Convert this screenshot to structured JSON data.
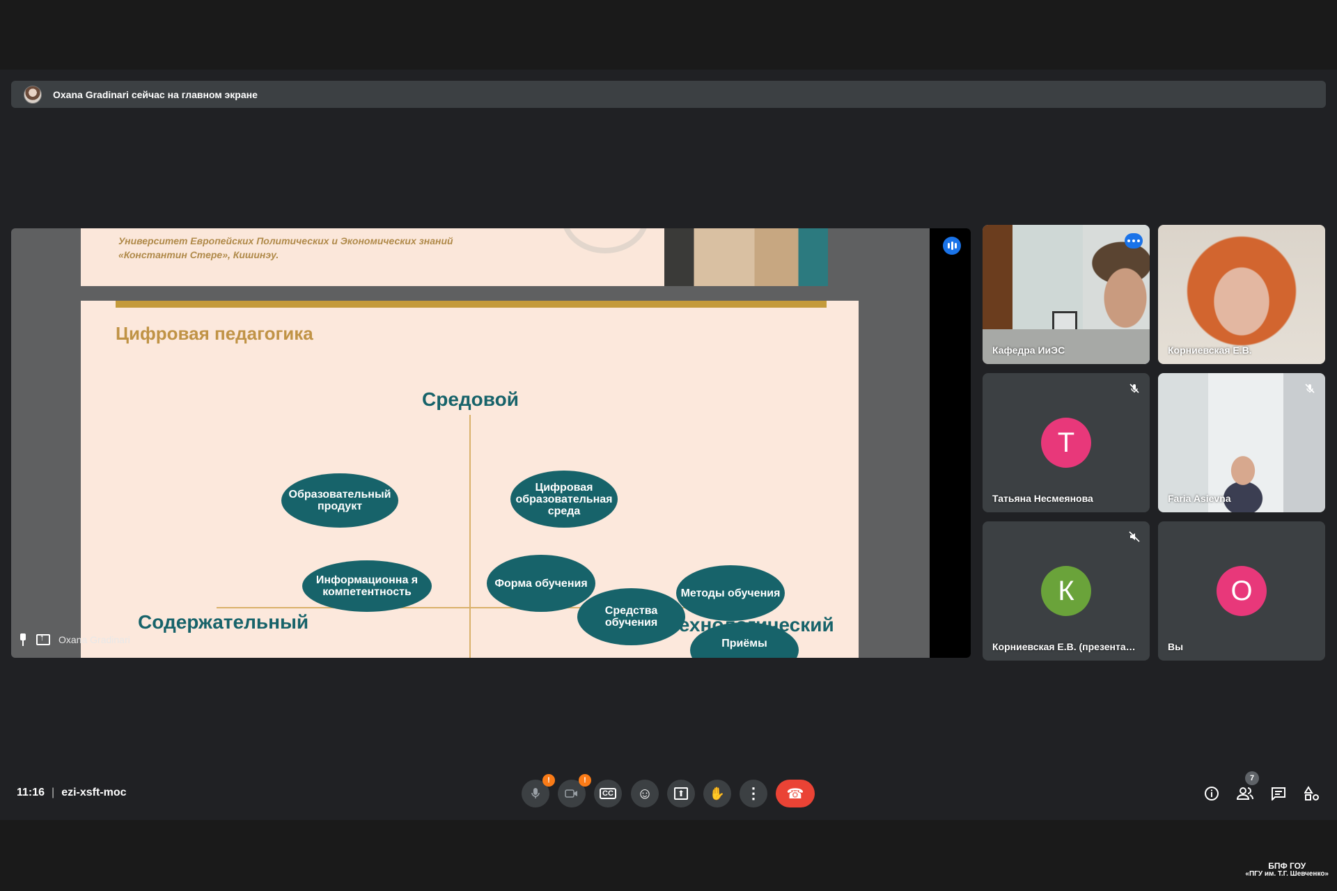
{
  "notification": {
    "text": "Oxana Gradinari сейчас на главном экране"
  },
  "presentation": {
    "presenter_name": "Oxana Gradinari",
    "prev_slide_text": "Университет Европейских Политических и Экономических знаний «Константин Стере», Кишинэу.",
    "slide": {
      "title": "Цифровая педагогика",
      "axis_top": "Средовой",
      "axis_left": "Содержательный",
      "axis_right": "Технологический",
      "ellipses": [
        "Образовательный продукт",
        "Цифровая образовательная среда",
        "Информационна я компетентность",
        "Форма обучения",
        "Средства обучения",
        "Методы обучения",
        "Приёмы"
      ]
    }
  },
  "participants": [
    {
      "name": "Кафедра ИиЭС",
      "video": true,
      "active": true
    },
    {
      "name": "Корниевская Е.В.",
      "video": true
    },
    {
      "name": "Татьяна Несмеянова",
      "initial": "Т",
      "color": "#e8387a",
      "muted": true
    },
    {
      "name": "Faria Asievna",
      "video": true,
      "muted": true
    },
    {
      "name": "Корниевская Е.В. (презентация)",
      "initial": "К",
      "color": "#6aa33a",
      "muted": true
    },
    {
      "name": "Вы",
      "initial": "О",
      "color": "#e8387a"
    }
  ],
  "meeting": {
    "time": "11:16",
    "code": "ezi-xsft-moc",
    "participant_count": "7"
  },
  "controls": {
    "mic_icon": "mic-off-icon",
    "cam_icon": "camera-off-icon",
    "captions_icon": "CC",
    "emoji_icon": "☺",
    "present_icon": "⬆",
    "hand_icon": "✋",
    "more_icon": "⋮",
    "end_icon": "☎"
  },
  "watermark": {
    "line1": "БПФ ГОУ",
    "line2": "«ПГУ им. Т.Г. Шевченко»"
  }
}
